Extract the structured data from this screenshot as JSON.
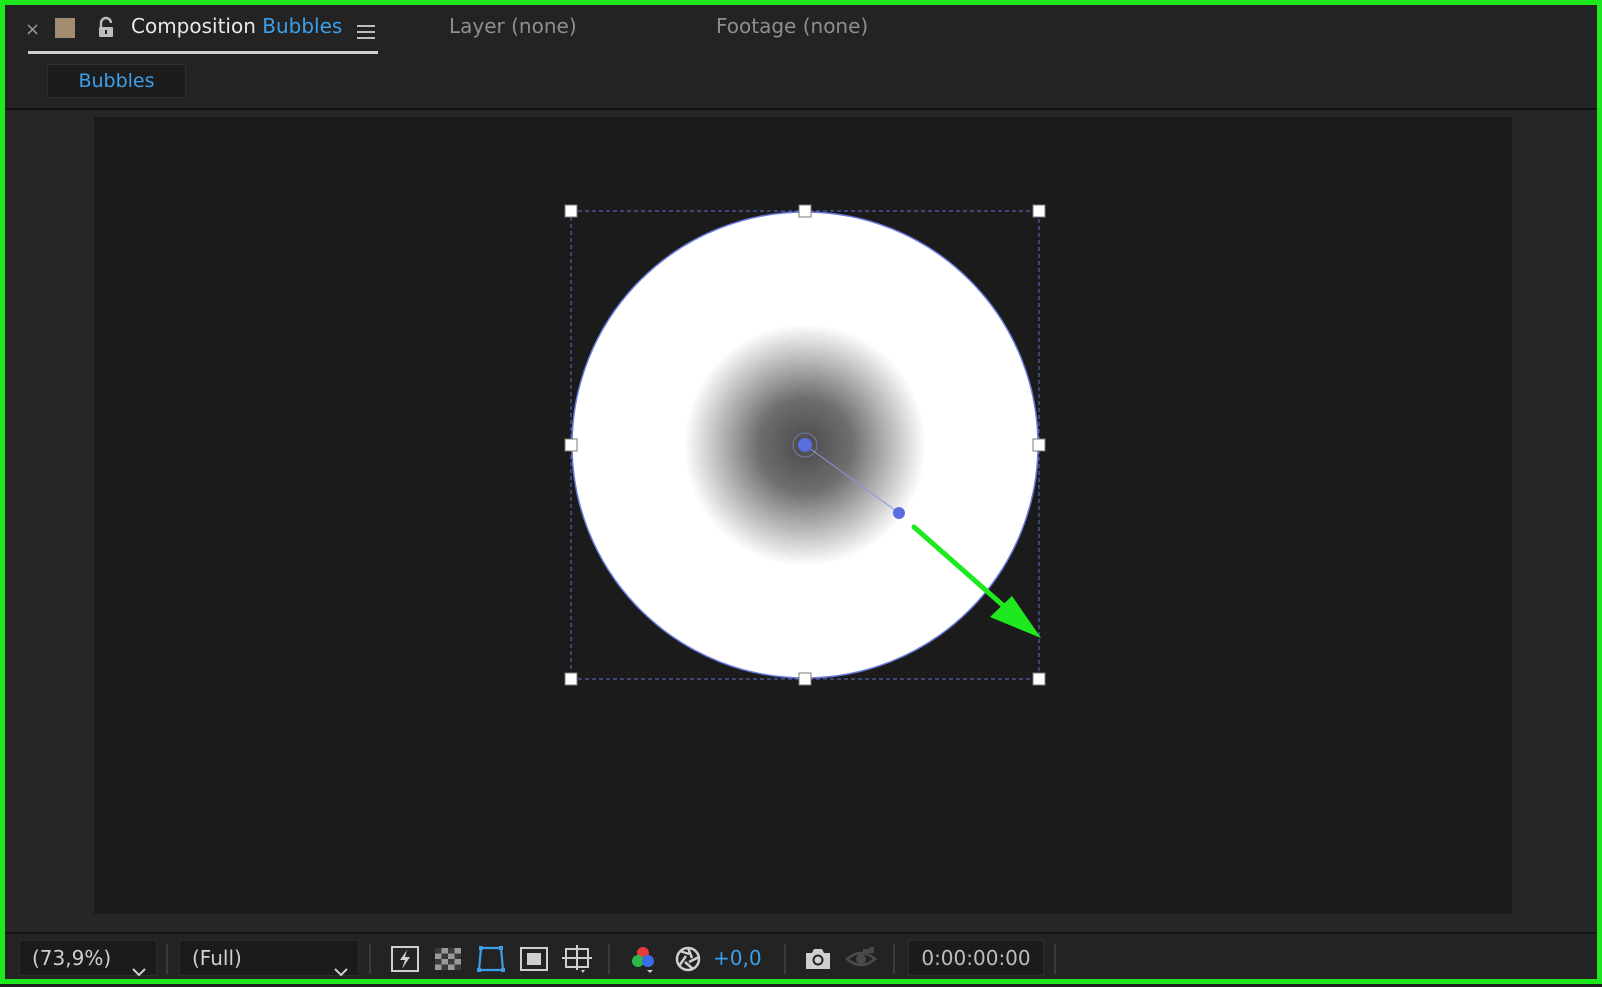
{
  "window": {
    "close_glyph": "×",
    "label_color": "#a28c6e",
    "tabs": [
      {
        "prefix": "Composition",
        "name": "Bubbles",
        "active": true
      },
      {
        "label": "Layer (none)",
        "active": false
      },
      {
        "label": "Footage (none)",
        "active": false
      }
    ]
  },
  "breadcrumb": {
    "label": "Bubbles"
  },
  "viewer": {
    "layer": "white circle with radial gray gradient center",
    "annotation": "green arrow"
  },
  "toolbar": {
    "magnification": "(73,9%)",
    "resolution": "(Full)",
    "exposure": "+0,0",
    "timecode": "0:00:00:00",
    "icons": [
      "fast-previews-icon",
      "transparency-grid-icon",
      "mask-path-visibility-icon",
      "region-of-interest-icon",
      "guides-grid-icon",
      "show-channel-icon",
      "reset-exposure-icon",
      "snapshot-camera-icon",
      "show-snapshot-icon"
    ]
  },
  "colors": {
    "accent_blue": "#3d9ee8",
    "frame_green": "#1ee81e",
    "handle_blue": "#5b6ee0"
  }
}
